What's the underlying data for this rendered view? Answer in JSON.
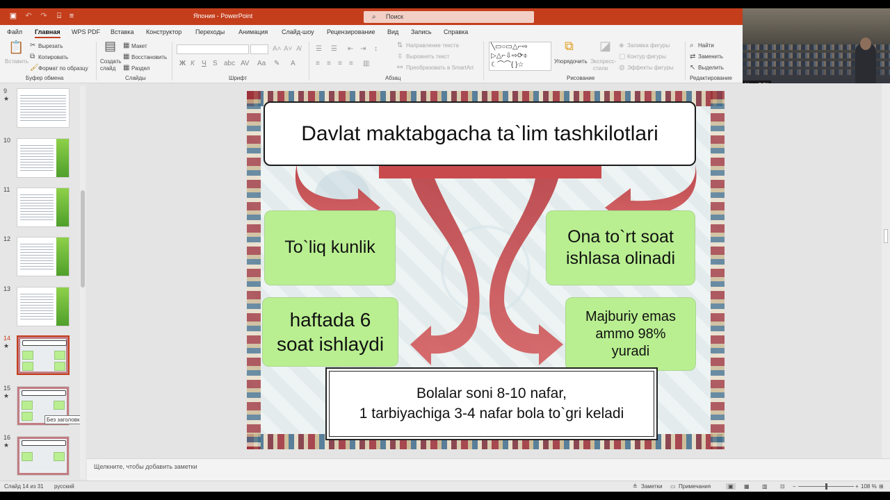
{
  "window": {
    "doc_title": "Япония - PowerPoint",
    "search_placeholder": "Поиск"
  },
  "tabs": [
    "Файл",
    "Главная",
    "WPS PDF",
    "Вставка",
    "Конструктор",
    "Переходы",
    "Анимация",
    "Слайд-шоу",
    "Рецензирование",
    "Вид",
    "Запись",
    "Справка"
  ],
  "active_tab": "Главная",
  "ribbon": {
    "clipboard": {
      "paste": "Вставить",
      "cut": "Вырезать",
      "copy": "Копировать",
      "format_painter": "Формат по образцу",
      "group": "Буфер обмена"
    },
    "slides": {
      "new_slide_1": "Создать",
      "new_slide_2": "слайд",
      "layout": "Макет",
      "reset": "Восстановить",
      "section": "Раздел",
      "group": "Слайды"
    },
    "font": {
      "group": "Шрифт"
    },
    "paragraph": {
      "text_direction": "Направление текста",
      "align_text": "Выровнять текст",
      "smartart": "Преобразовать в SmartArt",
      "group": "Абзац"
    },
    "drawing": {
      "arrange": "Упорядочить",
      "quick_styles_1": "Экспресс-",
      "quick_styles_2": "стили",
      "shape_fill": "Заливка фигуры",
      "shape_outline": "Контур фигуры",
      "shape_effects": "Эффекты фигуры",
      "group": "Рисование"
    },
    "editing": {
      "find": "Найти",
      "replace": "Заменить",
      "select": "Выделить",
      "group": "Редактирование"
    }
  },
  "video": {
    "label": "NamDPI"
  },
  "thumbnails": [
    {
      "num": "9",
      "star": "★"
    },
    {
      "num": "10",
      "star": ""
    },
    {
      "num": "11",
      "star": ""
    },
    {
      "num": "12",
      "star": ""
    },
    {
      "num": "13",
      "star": ""
    },
    {
      "num": "14",
      "star": "★"
    },
    {
      "num": "15",
      "star": "★"
    },
    {
      "num": "16",
      "star": "★"
    }
  ],
  "tooltip": "Без заголовка",
  "slide": {
    "title": "Davlat maktabgacha ta`lim tashkilotlari",
    "box_tl": "To`liq kunlik",
    "box_tr": "Ona to`rt soat\nishlasa olinadi",
    "box_bl": "haftada 6\nsoat ishlaydi",
    "box_br": "Majburiy emas\nammo 98%\nyuradi",
    "bottom": "Bolalar soni 8-10 nafar,\n1 tarbiyachiga 3-4 nafar bola to`gri keladi"
  },
  "notes_placeholder": "Щелкните, чтобы добавить заметки",
  "status": {
    "slide_info": "Слайд 14 из 31",
    "language": "русский",
    "notes": "Заметки",
    "comments": "Примечания",
    "zoom": "108 %"
  }
}
